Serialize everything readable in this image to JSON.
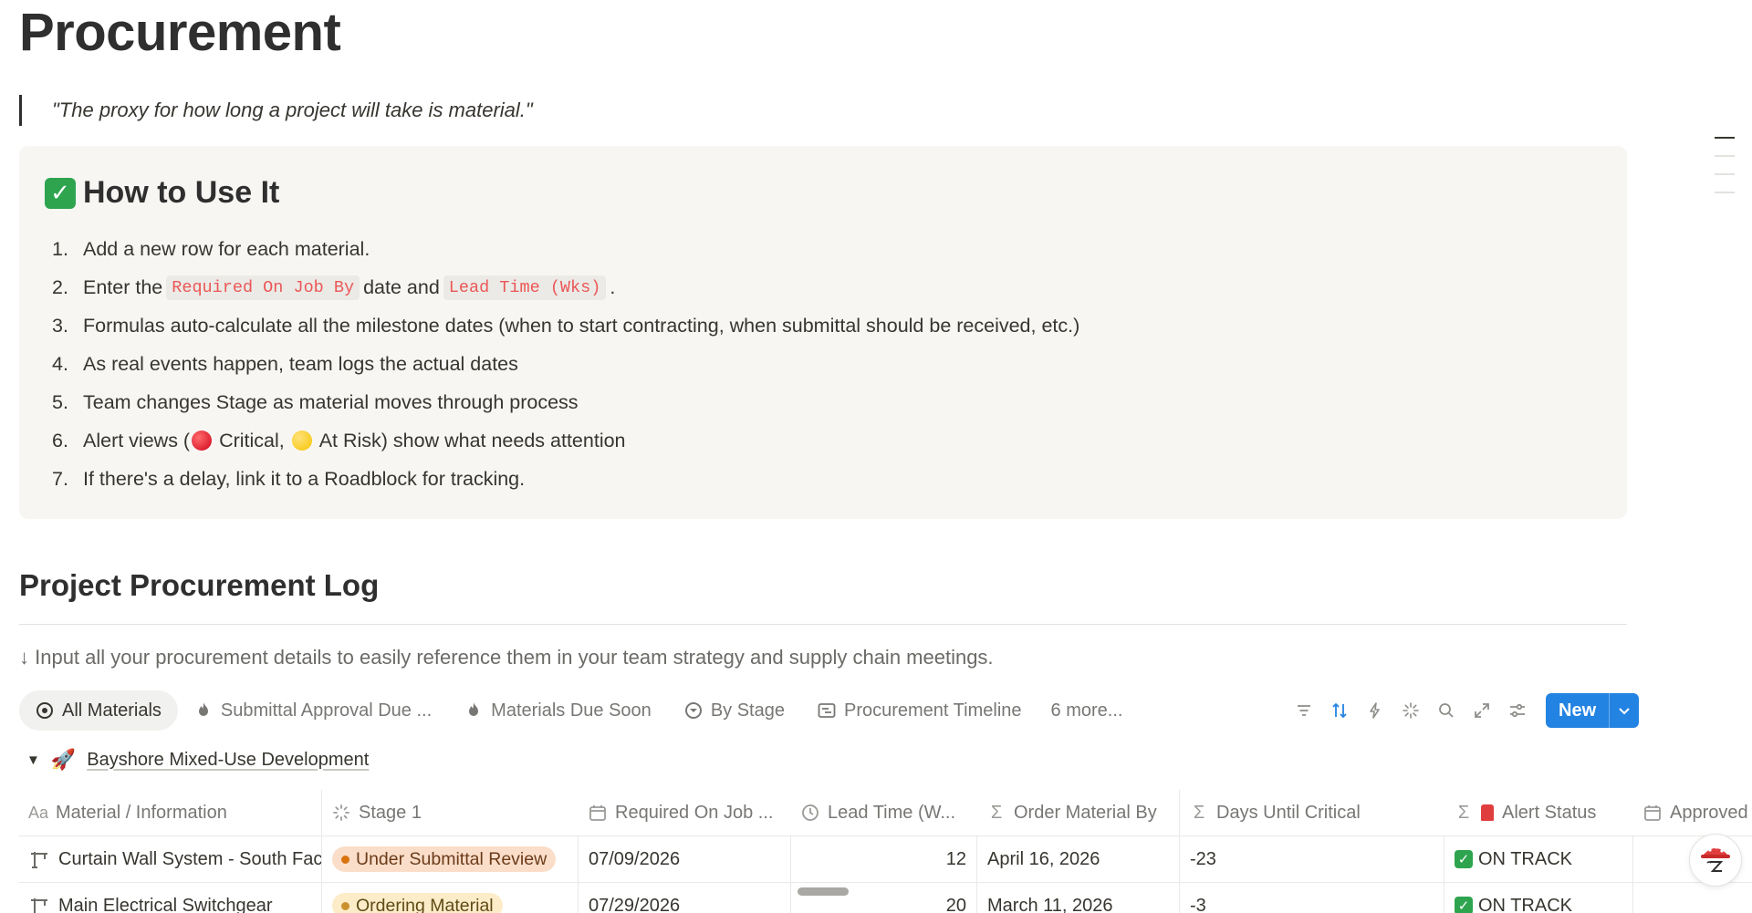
{
  "page": {
    "title": "Procurement",
    "quote": "\"The proxy for how long a project will take is material.\""
  },
  "callout": {
    "heading": "How to Use It",
    "steps": [
      {
        "num": "1.",
        "text": "Add a new row for each material."
      },
      {
        "num": "2.",
        "prefix": "Enter the",
        "code1": "Required On Job By",
        "middle": "date and",
        "code2": "Lead Time (Wks)",
        "suffix": "."
      },
      {
        "num": "3.",
        "text": "Formulas auto-calculate all the milestone dates (when to start contracting, when submittal should be received, etc.)"
      },
      {
        "num": "4.",
        "text": "As real events happen, team logs the actual dates"
      },
      {
        "num": "5.",
        "text": "Team changes Stage as material moves through process"
      },
      {
        "num": "6.",
        "prefix": "Alert views (",
        "critical": "Critical,",
        "atrisk": "At Risk) show what needs attention"
      },
      {
        "num": "7.",
        "text": "If there's a delay, link it to a Roadblock for tracking."
      }
    ]
  },
  "log": {
    "title": "Project Procurement Log",
    "description": "↓ Input all your procurement details to easily reference them in your team strategy and supply chain meetings.",
    "tabs": [
      {
        "label": "All Materials",
        "icon": "target-icon"
      },
      {
        "label": "Submittal Approval Due ...",
        "icon": "fire-icon"
      },
      {
        "label": "Materials Due Soon",
        "icon": "fire-icon"
      },
      {
        "label": "By Stage",
        "icon": "chevron-circle-icon"
      },
      {
        "label": "Procurement Timeline",
        "icon": "timeline-icon"
      },
      {
        "label": "6 more..."
      }
    ],
    "new_label": "New",
    "group": "Bayshore Mixed-Use Development",
    "columns": [
      "Material / Information",
      "Stage 1",
      "Required On Job ...",
      "Lead Time (W...",
      "Order Material By",
      "Days Until Critical",
      "Alert Status",
      "Approved ("
    ],
    "rows": [
      {
        "material": "Curtain Wall System - South Facade",
        "stage": "Under Submittal Review",
        "required": "07/09/2026",
        "lead": "12",
        "order_by": "April 16, 2026",
        "days": "-23",
        "alert": "ON TRACK"
      },
      {
        "material": "Main Electrical Switchgear",
        "stage": "Ordering Material",
        "required": "07/29/2026",
        "lead": "20",
        "order_by": "March 11, 2026",
        "days": "-3",
        "alert": "ON TRACK"
      }
    ]
  },
  "colors": {
    "accent": "#2383e2",
    "code_text": "#eb5757",
    "stage_orange": "#fadec9",
    "stage_yellow": "#fdecc8",
    "on_track": "#2ea44f"
  }
}
